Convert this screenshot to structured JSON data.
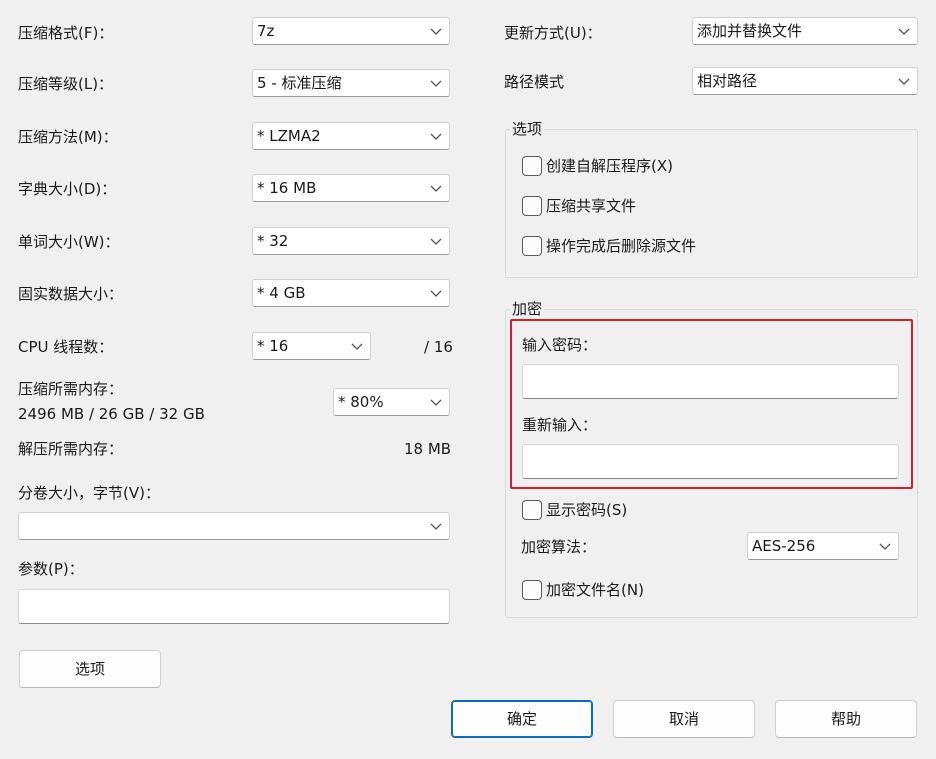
{
  "left": {
    "format": {
      "label": "压缩格式(F)：",
      "value": "7z"
    },
    "level": {
      "label": "压缩等级(L)：",
      "value": "5 - 标准压缩"
    },
    "method": {
      "label": "压缩方法(M)：",
      "value": "*  LZMA2"
    },
    "dict": {
      "label": "字典大小(D)：",
      "value": "*  16 MB"
    },
    "word": {
      "label": "单词大小(W)：",
      "value": "*  32"
    },
    "solid": {
      "label": "固实数据大小：",
      "value": "*  4 GB"
    },
    "threads": {
      "label": "CPU 线程数：",
      "value": "*  16",
      "max": "/ 16"
    },
    "mem_compress": {
      "label": "压缩所需内存：",
      "detail": "2496 MB / 26 GB / 32 GB",
      "value": "*  80%"
    },
    "mem_decompress": {
      "label": "解压所需内存：",
      "value": "18 MB"
    },
    "volume": {
      "label": "分卷大小，字节(V)：",
      "value": ""
    },
    "params": {
      "label": "参数(P)：",
      "value": ""
    },
    "options_button": "选项"
  },
  "right": {
    "update": {
      "label": "更新方式(U)：",
      "value": "添加并替换文件"
    },
    "path": {
      "label": "路径模式",
      "value": "相对路径"
    },
    "options_group": {
      "title": "选项",
      "items": [
        "创建自解压程序(X)",
        "压缩共享文件",
        "操作完成后删除源文件"
      ]
    },
    "encryption": {
      "title": "加密",
      "password_label": "输入密码：",
      "password_value": "",
      "reenter_label": "重新输入：",
      "reenter_value": "",
      "show_password": "显示密码(S)",
      "algo_label": "加密算法：",
      "algo_value": "AES-256",
      "encrypt_names": "加密文件名(N)"
    }
  },
  "buttons": {
    "ok": "确定",
    "cancel": "取消",
    "help": "帮助"
  },
  "colors": {
    "highlight": "#d71d2b",
    "accent": "#0f6cbd"
  }
}
